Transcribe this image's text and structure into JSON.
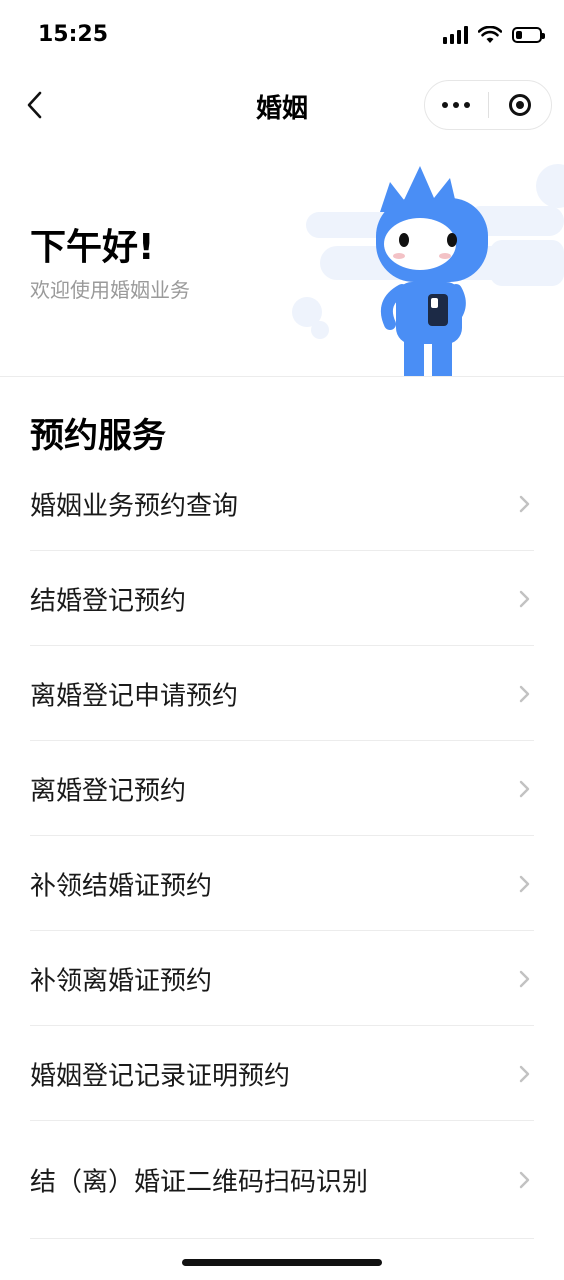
{
  "status_bar": {
    "time": "15:25",
    "signal_icon": "cellular-signal-icon",
    "wifi_icon": "wifi-icon",
    "battery_icon": "battery-icon",
    "battery_level": 0.25
  },
  "nav": {
    "title": "婚姻",
    "back_icon": "chevron-left-icon",
    "more_icon": "more-dots-icon",
    "close_icon": "target-circle-icon"
  },
  "hero": {
    "greeting": "下午好!",
    "subtitle": "欢迎使用婚姻业务",
    "mascot": "mascot-illustration"
  },
  "services": {
    "title": "预约服务",
    "items": [
      {
        "label": "婚姻业务预约查询"
      },
      {
        "label": "结婚登记预约"
      },
      {
        "label": "离婚登记申请预约"
      },
      {
        "label": "离婚登记预约"
      },
      {
        "label": "补领结婚证预约"
      },
      {
        "label": "补领离婚证预约"
      },
      {
        "label": "婚姻登记记录证明预约"
      },
      {
        "label": "结（离）婚证二维码扫码识别"
      }
    ]
  },
  "colors": {
    "mascot_blue": "#4a8ef5",
    "hero_bg_shape": "#eef3fc",
    "chevron": "#c2c2c2",
    "subtitle": "#9a9a9a"
  }
}
